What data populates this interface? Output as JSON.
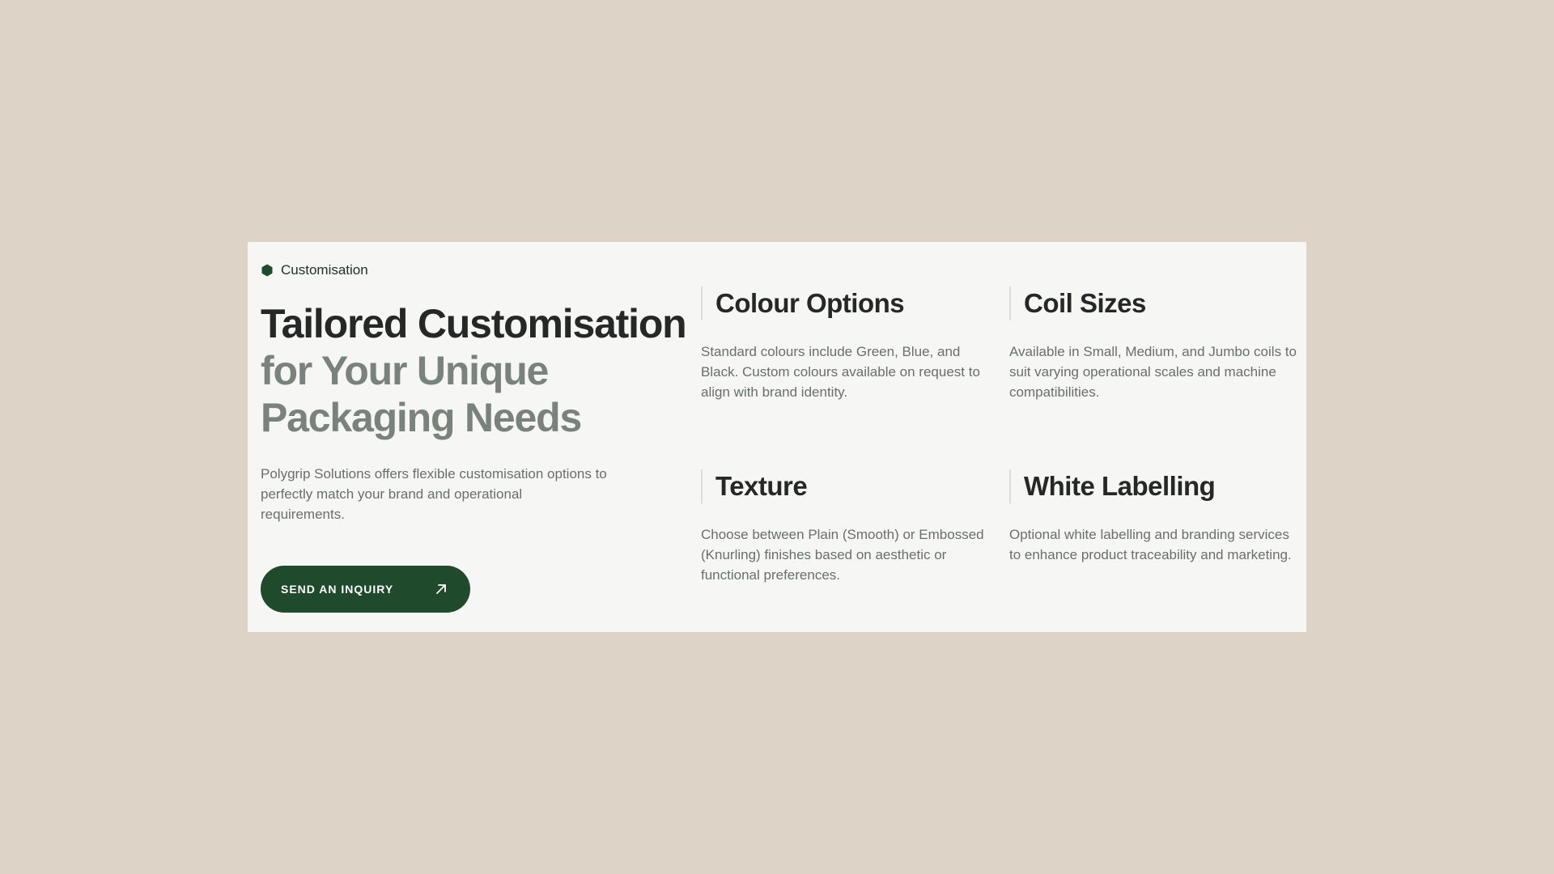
{
  "section": {
    "eyebrow": "Customisation",
    "headline_line1": "Tailored Customisation",
    "headline_line2": "for Your Unique",
    "headline_line3": "Packaging Needs",
    "intro": "Polygrip Solutions offers flexible customisation options to perfectly match your brand and operational requirements.",
    "cta_label": "SEND AN INQUIRY"
  },
  "features": [
    {
      "title": "Colour Options",
      "description": "Standard colours include Green, Blue, and Black. Custom colours available on request to align with brand identity."
    },
    {
      "title": "Coil Sizes",
      "description": "Available in Small, Medium, and Jumbo coils to suit varying operational scales and machine compatibilities."
    },
    {
      "title": "Texture",
      "description": "Choose between Plain (Smooth) or Embossed (Knurling) finishes based on aesthetic or functional preferences."
    },
    {
      "title": "White Labelling",
      "description": "Optional white labelling and branding services to enhance product traceability and marketing."
    }
  ],
  "icons": {
    "eyebrow_icon": "hexagon-icon",
    "cta_icon": "arrow-up-right-icon"
  },
  "colors": {
    "page_background": "#ddd3c7",
    "card_background": "#f6f6f5",
    "accent_green": "#1f4a2c",
    "heading_dark": "#252826",
    "heading_muted": "#7a827c",
    "body_text": "#68706b"
  }
}
